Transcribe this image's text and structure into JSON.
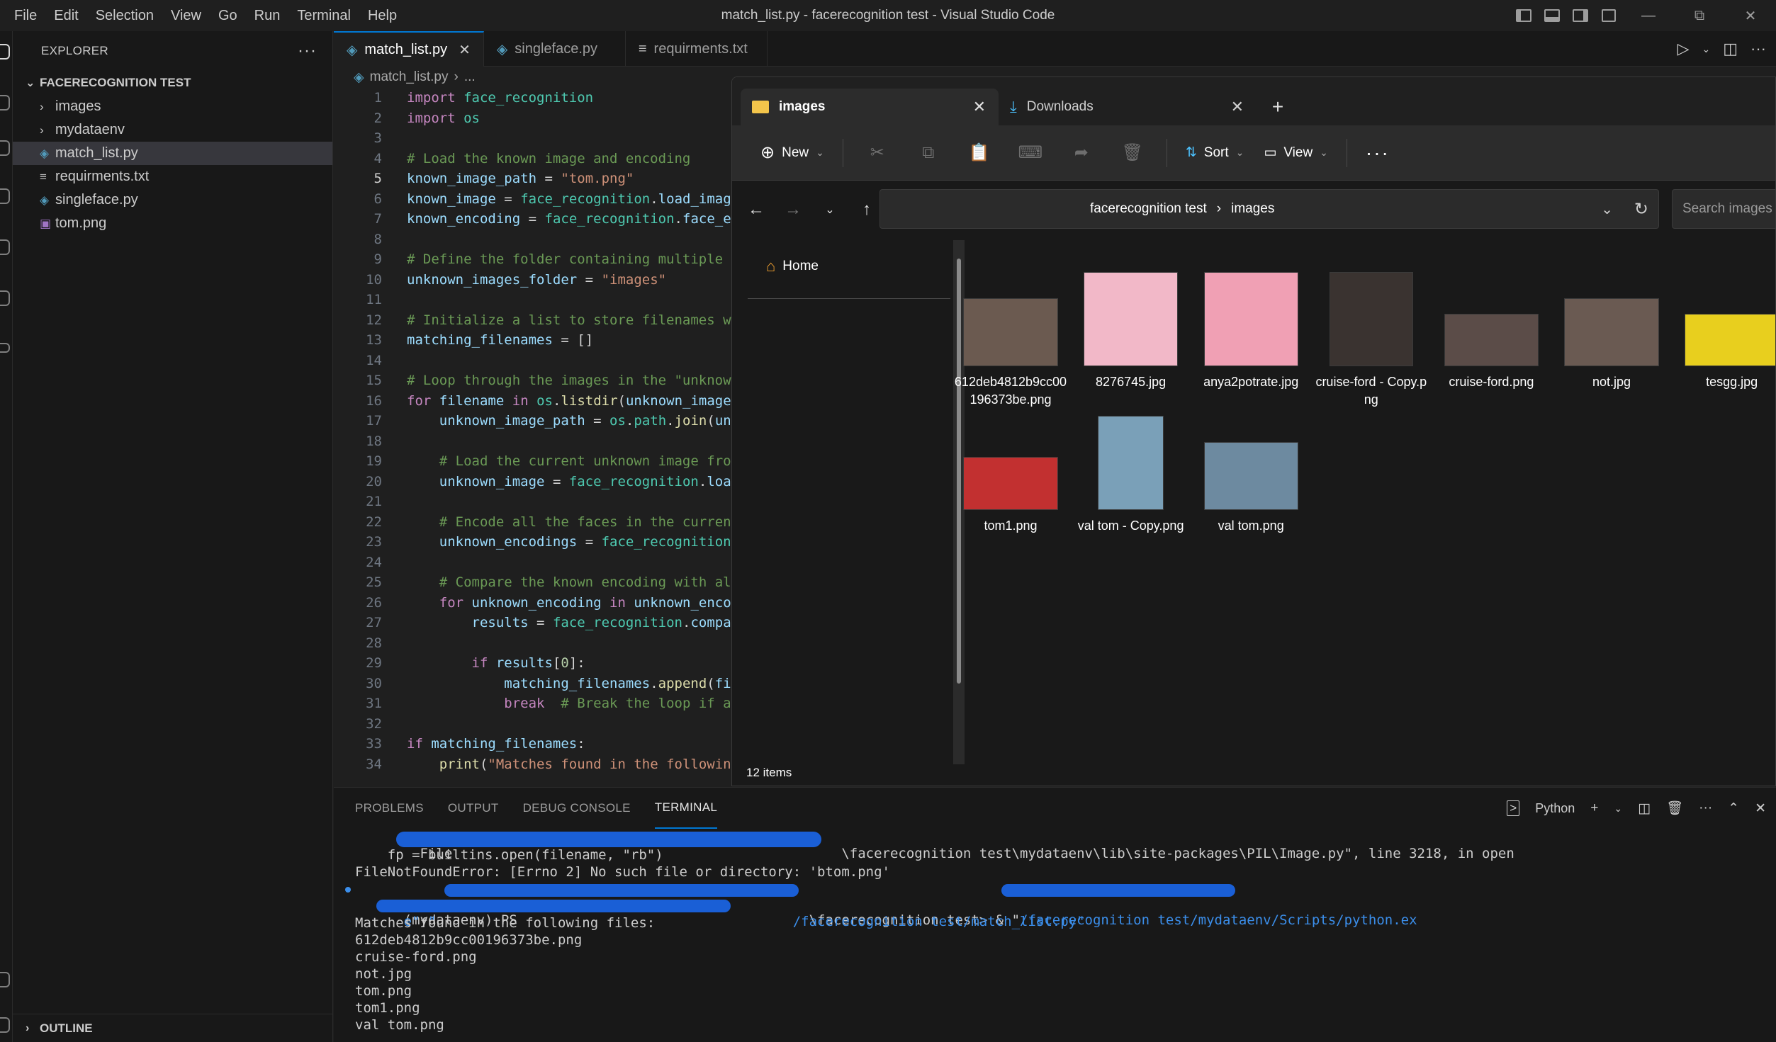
{
  "window": {
    "title": "match_list.py - facerecognition test - Visual Studio Code",
    "menu": [
      "File",
      "Edit",
      "Selection",
      "View",
      "Go",
      "Run",
      "Terminal",
      "Help"
    ]
  },
  "sidebar": {
    "header": "EXPLORER",
    "folder": "FACERECOGNITION TEST",
    "items": [
      {
        "label": "images",
        "kind": "folder"
      },
      {
        "label": "mydataenv",
        "kind": "folder"
      },
      {
        "label": "match_list.py",
        "kind": "py"
      },
      {
        "label": "requirments.txt",
        "kind": "txt"
      },
      {
        "label": "singleface.py",
        "kind": "py"
      },
      {
        "label": "tom.png",
        "kind": "png"
      }
    ],
    "outline": "OUTLINE"
  },
  "editor": {
    "tabs": [
      {
        "label": "match_list.py",
        "active": true
      },
      {
        "label": "singleface.py",
        "active": false
      },
      {
        "label": "requirments.txt",
        "active": false
      }
    ],
    "breadcrumb": {
      "file": "match_list.py",
      "rest": "..."
    },
    "lines": [
      {
        "n": "1",
        "text": "import face_recognition"
      },
      {
        "n": "2",
        "text": "import os"
      },
      {
        "n": "3",
        "text": ""
      },
      {
        "n": "4",
        "text": "# Load the known image and encoding"
      },
      {
        "n": "5",
        "text": "known_image_path = \"tom.png\""
      },
      {
        "n": "6",
        "text": "known_image = face_recognition.load_imag"
      },
      {
        "n": "7",
        "text": "known_encoding = face_recognition.face_e"
      },
      {
        "n": "8",
        "text": ""
      },
      {
        "n": "9",
        "text": "# Define the folder containing multiple"
      },
      {
        "n": "10",
        "text": "unknown_images_folder = \"images\""
      },
      {
        "n": "11",
        "text": ""
      },
      {
        "n": "12",
        "text": "# Initialize a list to store filenames w"
      },
      {
        "n": "13",
        "text": "matching_filenames = []"
      },
      {
        "n": "14",
        "text": ""
      },
      {
        "n": "15",
        "text": "# Loop through the images in the \"unknow"
      },
      {
        "n": "16",
        "text": "for filename in os.listdir(unknown_image"
      },
      {
        "n": "17",
        "text": "    unknown_image_path = os.path.join(un"
      },
      {
        "n": "18",
        "text": ""
      },
      {
        "n": "19",
        "text": "    # Load the current unknown image fro"
      },
      {
        "n": "20",
        "text": "    unknown_image = face_recognition.loa"
      },
      {
        "n": "21",
        "text": ""
      },
      {
        "n": "22",
        "text": "    # Encode all the faces in the curren"
      },
      {
        "n": "23",
        "text": "    unknown_encodings = face_recognition"
      },
      {
        "n": "24",
        "text": ""
      },
      {
        "n": "25",
        "text": "    # Compare the known encoding with al"
      },
      {
        "n": "26",
        "text": "    for unknown_encoding in unknown_enco"
      },
      {
        "n": "27",
        "text": "        results = face_recognition.compa"
      },
      {
        "n": "28",
        "text": ""
      },
      {
        "n": "29",
        "text": "        if results[0]:"
      },
      {
        "n": "30",
        "text": "            matching_filenames.append(fi"
      },
      {
        "n": "31",
        "text": "            break  # Break the loop if a"
      },
      {
        "n": "32",
        "text": ""
      },
      {
        "n": "33",
        "text": "if matching_filenames:"
      },
      {
        "n": "34",
        "text": "    print(\"Matches found in the followin"
      }
    ]
  },
  "panel": {
    "tabs": [
      "PROBLEMS",
      "OUTPUT",
      "DEBUG CONSOLE",
      "TERMINAL"
    ],
    "active_tab": "TERMINAL",
    "shell": "Python",
    "terminal_lines": [
      "  File                                                \\facerecognition test\\mydataenv\\lib\\site-packages\\PIL\\Image.py\", line 3218, in open",
      "    fp = builtins.open(filename, \"rb\")",
      "FileNotFoundError: [Errno 2] No such file or directory: 'btom.png'",
      "(mydataenv) PS                                    \\facerecognition test> & \"",
      "e\" \"                                            /facerecognition test/match_list.py\"",
      "Matches found in the following files:",
      "612deb4812b9cc00196373be.png",
      "cruise-ford.png",
      "not.jpg",
      "tom.png",
      "tom1.png",
      "val tom.png"
    ],
    "line4_tail": "/facerecognition test/mydataenv/Scripts/python.ex"
  },
  "file_explorer": {
    "tabs": [
      {
        "label": "images",
        "active": true
      },
      {
        "label": "Downloads",
        "active": false
      }
    ],
    "toolbar": {
      "new": "New",
      "sort": "Sort",
      "view": "View"
    },
    "path": [
      "facerecognition test",
      "images"
    ],
    "search_placeholder": "Search images",
    "nav_home": "Home",
    "status": "12 items",
    "files": [
      {
        "name": "612deb4812b9cc00196373be.png",
        "color": "#6b5a50"
      },
      {
        "name": "8276745.jpg",
        "color": "#f2b8c8"
      },
      {
        "name": "anya2potrate.jpg",
        "color": "#f0a0b4"
      },
      {
        "name": "cruise-ford - Copy.png",
        "color": "#3a3330"
      },
      {
        "name": "cruise-ford.png",
        "color": "#5b4c48"
      },
      {
        "name": "not.jpg",
        "color": "#6a5a52"
      },
      {
        "name": "tesgg.jpg",
        "color": "#e8cf1e"
      },
      {
        "name": "tom1.png",
        "color": "#c23030"
      },
      {
        "name": "val tom - Copy.png",
        "color": "#7aa0b8"
      },
      {
        "name": "val tom.png",
        "color": "#6d8aa0"
      }
    ]
  }
}
